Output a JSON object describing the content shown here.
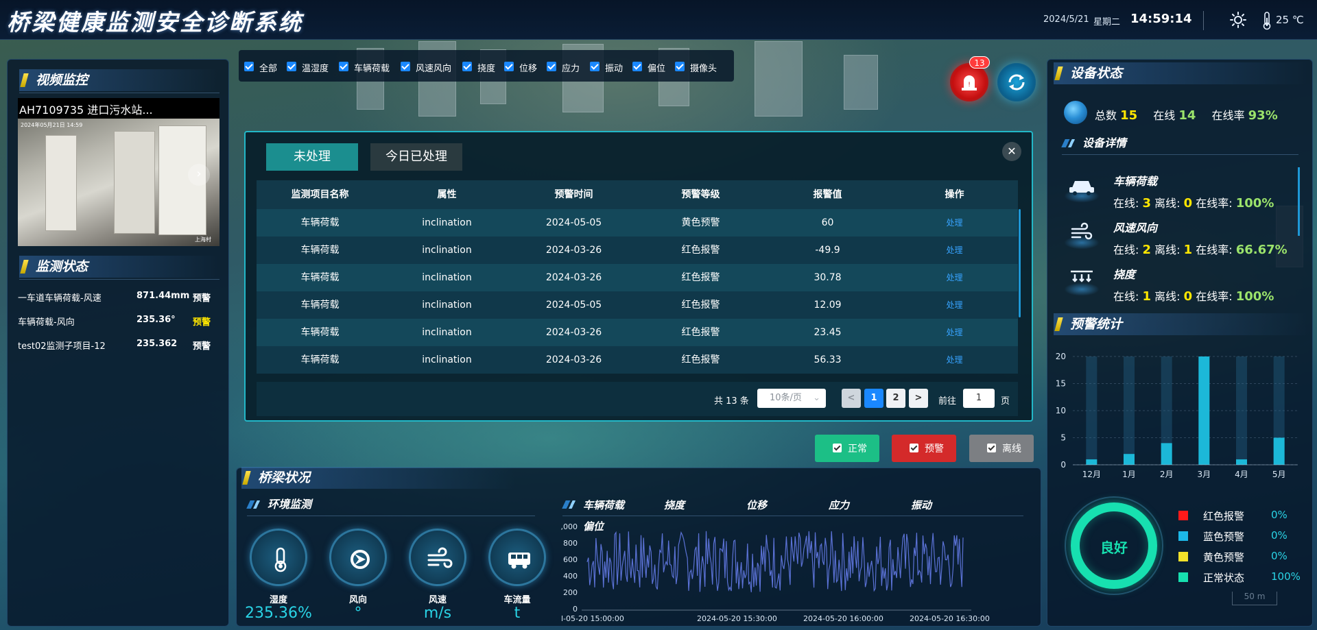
{
  "header": {
    "title": "桥梁健康监测安全诊断系统",
    "date": "2024/5/21",
    "weekday": "星期二",
    "time": "14:59:14",
    "temperature": "25 ℃",
    "weather_icon": "sun-icon",
    "thermometer_icon": "thermometer-icon"
  },
  "video": {
    "section_title": "视频监控",
    "camera_name": "AH7109735 进口污水站...",
    "overlay_stamp": "2024年05月21日 14:59",
    "overlay_corner": "上海村",
    "next_icon": "chevron-right-icon"
  },
  "monitor": {
    "section_title": "监测状态",
    "rows": [
      {
        "name": "一车道车辆荷载-风速",
        "value": "871.44mm",
        "status": "预警",
        "status_color": "white"
      },
      {
        "name": "车辆荷载-风向",
        "value": "235.36°",
        "status": "预警",
        "status_color": "yellow"
      },
      {
        "name": "test02监测子项目-12",
        "value": "235.362",
        "status": "预警",
        "status_color": "white"
      }
    ]
  },
  "filters": {
    "items": [
      "全部",
      "温湿度",
      "车辆荷载",
      "风速风向",
      "挠度",
      "位移",
      "应力",
      "振动",
      "偏位",
      "摄像头"
    ]
  },
  "alarm": {
    "badge": "13",
    "alarm_icon": "siren-icon",
    "refresh_icon": "refresh-icon"
  },
  "dialog": {
    "tabs": [
      "未处理",
      "今日已处理"
    ],
    "close": "✕",
    "columns": [
      "监测项目名称",
      "属性",
      "预警时间",
      "预警等级",
      "报警值",
      "操作"
    ],
    "rows": [
      [
        "车辆荷载",
        "inclination",
        "2024-05-05",
        "黄色预警",
        "60",
        "处理"
      ],
      [
        "车辆荷载",
        "inclination",
        "2024-03-26",
        "红色报警",
        "-49.9",
        "处理"
      ],
      [
        "车辆荷载",
        "inclination",
        "2024-03-26",
        "红色报警",
        "30.78",
        "处理"
      ],
      [
        "车辆荷载",
        "inclination",
        "2024-05-05",
        "红色报警",
        "12.09",
        "处理"
      ],
      [
        "车辆荷载",
        "inclination",
        "2024-03-26",
        "红色报警",
        "23.45",
        "处理"
      ],
      [
        "车辆荷载",
        "inclination",
        "2024-03-26",
        "红色报警",
        "56.33",
        "处理"
      ]
    ],
    "pagination": {
      "total": "共 13 条",
      "page_size": "10条/页",
      "prev": "<",
      "pages": [
        "1",
        "2"
      ],
      "current": "1",
      "next": ">",
      "goto_label": "前往",
      "goto_value": "1",
      "goto_unit": "页"
    }
  },
  "legend_buttons": [
    {
      "label": "正常",
      "color": "#1cbf86"
    },
    {
      "label": "预警",
      "color": "#d42a2a"
    },
    {
      "label": "离线",
      "color": "#7c7f83"
    }
  ],
  "bridge": {
    "section_title": "桥梁状况",
    "env_title": "环境监测",
    "env_items": [
      {
        "label": "湿度",
        "value": "235.36%",
        "icon": "thermometer-icon"
      },
      {
        "label": "风向",
        "value": "°",
        "icon": "wind-direction-icon"
      },
      {
        "label": "风速",
        "value": "m/s",
        "icon": "wind-icon"
      },
      {
        "label": "车流量",
        "value": "t",
        "icon": "bus-icon"
      }
    ],
    "chart_tabs": [
      "车辆荷载",
      "挠度",
      "位移",
      "应力",
      "振动"
    ],
    "chart_sub": "偏位"
  },
  "device": {
    "section_title": "设备状态",
    "total_label": "总数",
    "total": "15",
    "online_label": "在线",
    "online": "14",
    "rate_label": "在线率",
    "rate": "93%",
    "detail_title": "设备详情",
    "items": [
      {
        "name": "车辆荷载",
        "online_label": "在线:",
        "online": "3",
        "offline_label": "离线:",
        "offline": "0",
        "rate_label": "在线率:",
        "rate": "100%",
        "icon": "car-icon"
      },
      {
        "name": "风速风向",
        "online_label": "在线:",
        "online": "2",
        "offline_label": "离线:",
        "offline": "1",
        "rate_label": "在线率:",
        "rate": "66.67%",
        "icon": "wind-icon"
      },
      {
        "name": "挠度",
        "online_label": "在线:",
        "online": "1",
        "offline_label": "离线:",
        "offline": "0",
        "rate_label": "在线率:",
        "rate": "100%",
        "icon": "deflection-icon"
      }
    ]
  },
  "warning_stats": {
    "section_title": "预警统计",
    "ring_label": "良好",
    "legend": [
      {
        "name": "红色报警",
        "pct": "0%",
        "color": "#ff1a1a"
      },
      {
        "name": "蓝色预警",
        "pct": "0%",
        "color": "#1cb8e8"
      },
      {
        "name": "黄色预警",
        "pct": "0%",
        "color": "#f2e12a"
      },
      {
        "name": "正常状态",
        "pct": "100%",
        "color": "#17e0b0"
      }
    ],
    "scale": "50 m"
  },
  "chart_data": [
    {
      "type": "bar",
      "categories": [
        "12月",
        "1月",
        "2月",
        "3月",
        "4月",
        "5月"
      ],
      "values": [
        1,
        2,
        4,
        20,
        1,
        5
      ],
      "ylim": [
        0,
        20
      ],
      "yticks": [
        0,
        5,
        10,
        15,
        20
      ],
      "bar_color": "#1cb8d8"
    },
    {
      "type": "line",
      "x_ticks": [
        "l-05-20 15:00:00",
        "2024-05-20 15:30:00",
        "2024-05-20 16:00:00",
        "2024-05-20 16:30:00"
      ],
      "y_ticks": [
        "0",
        "200",
        "400",
        "600",
        "800",
        ",000"
      ],
      "ylim": [
        0,
        1000
      ],
      "line_color": "#5b72d6",
      "approx_range": [
        200,
        950
      ]
    }
  ]
}
